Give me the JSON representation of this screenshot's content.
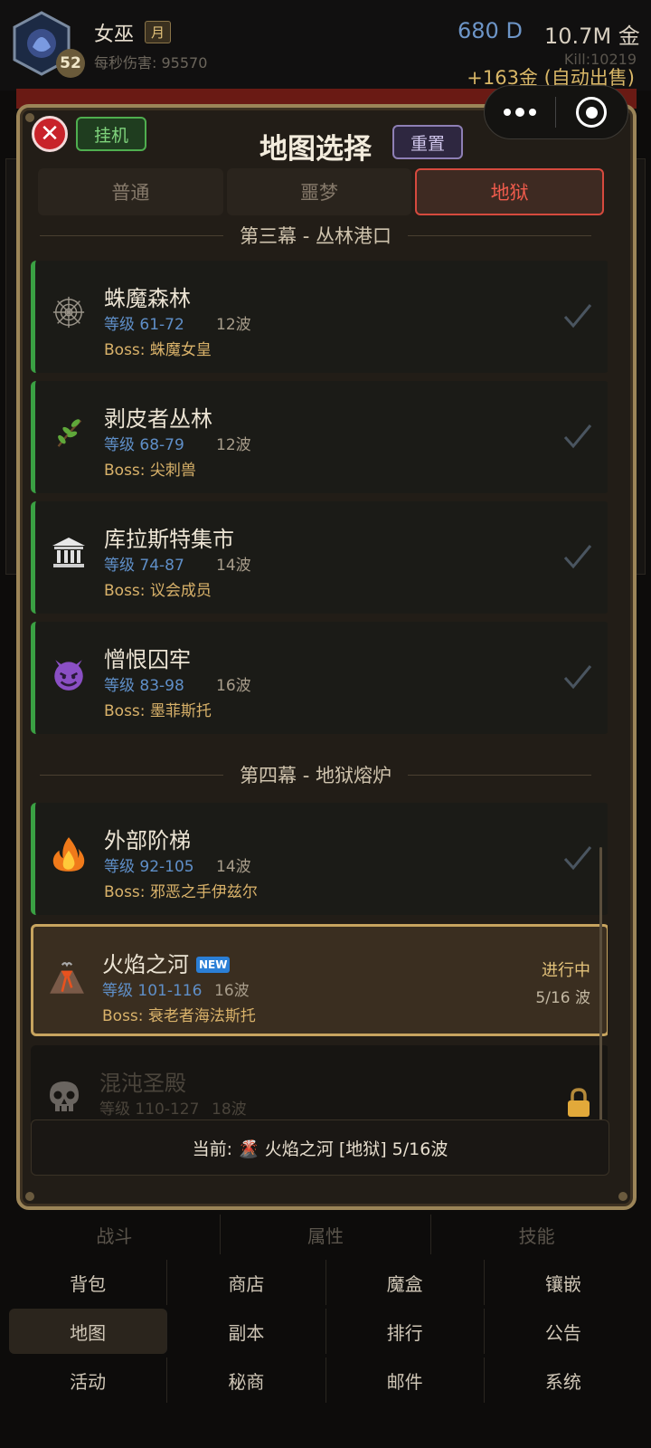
{
  "player": {
    "name": "女巫",
    "rank_tag": "月",
    "level": "52",
    "dps": "每秒伤害: 95570",
    "diamonds": "680 D",
    "gold": "10.7M 金",
    "kills": "Kill:10219",
    "auto_sell": "+163金 (自动出售)"
  },
  "modal": {
    "title": "地图选择",
    "idle_label": "挂机",
    "reset_label": "重置",
    "close_symbol": "✕",
    "tabs": [
      {
        "label": "普通",
        "active": false
      },
      {
        "label": "噩梦",
        "active": false
      },
      {
        "label": "地狱",
        "active": true
      }
    ],
    "acts": [
      {
        "title": "第三幕 - 丛林港口"
      },
      {
        "title": "第四幕 - 地狱熔炉"
      }
    ],
    "maps": [
      {
        "name": "蛛魔森林",
        "level": "等级 61-72",
        "waves": "12波",
        "boss": "Boss: 蛛魔女皇",
        "icon": "🕸️",
        "icon_name": "spider-web-icon",
        "state": "cleared"
      },
      {
        "name": "剥皮者丛林",
        "level": "等级 68-79",
        "waves": "12波",
        "boss": "Boss: 尖刺兽",
        "icon": "🌿",
        "icon_name": "herb-icon",
        "state": "cleared"
      },
      {
        "name": "库拉斯特集市",
        "level": "等级 74-87",
        "waves": "14波",
        "boss": "Boss: 议会成员",
        "icon": "🏛️",
        "icon_name": "temple-icon",
        "state": "cleared"
      },
      {
        "name": "憎恨囚牢",
        "level": "等级 83-98",
        "waves": "16波",
        "boss": "Boss: 墨菲斯托",
        "icon": "😈",
        "icon_name": "devil-icon",
        "state": "cleared"
      },
      {
        "name": "外部阶梯",
        "level": "等级 92-105",
        "waves": "14波",
        "boss": "Boss: 邪恶之手伊兹尔",
        "icon": "🔥",
        "icon_name": "fire-icon",
        "state": "cleared"
      },
      {
        "name": "火焰之河",
        "level": "等级 101-116",
        "waves": "16波",
        "boss": "Boss: 衰老者海法斯托",
        "icon": "🌋",
        "icon_name": "volcano-icon",
        "state": "current",
        "new_badge": "NEW",
        "status": "进行中",
        "progress": "5/16 波"
      },
      {
        "name": "混沌圣殿",
        "level": "等级 110-127",
        "waves": "18波",
        "boss": "",
        "icon": "💀",
        "icon_name": "skull-icon",
        "state": "locked"
      }
    ],
    "current_text": "当前: 🌋 火焰之河 [地狱] 5/16波"
  },
  "bottom_nav": {
    "row1": [
      "战斗",
      "属性",
      "技能"
    ],
    "row2": [
      "背包",
      "商店",
      "魔盒",
      "镶嵌"
    ],
    "row3": [
      "地图",
      "副本",
      "排行",
      "公告"
    ],
    "row4": [
      "活动",
      "秘商",
      "邮件",
      "系统"
    ],
    "active": "地图"
  },
  "colors": {
    "accent_gold": "#c7a45f",
    "hell_red": "#ef5b4c",
    "cleared_green": "#3aa043",
    "level_blue": "#5f8fc8"
  }
}
